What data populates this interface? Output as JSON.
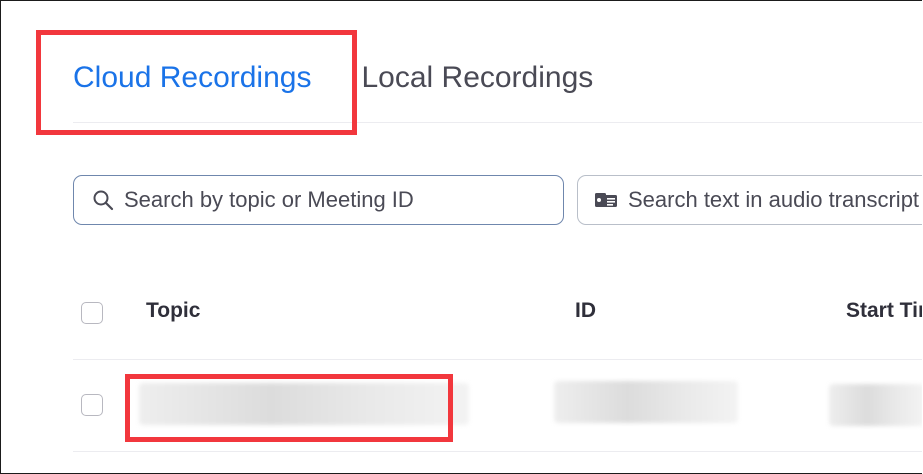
{
  "tabs": [
    {
      "label": "Cloud Recordings",
      "active": true
    },
    {
      "label": "Local Recordings",
      "active": false
    }
  ],
  "search": {
    "topic_placeholder": "Search by topic or Meeting ID",
    "transcript_placeholder": "Search text in audio transcript"
  },
  "table": {
    "columns": [
      "Topic",
      "ID",
      "Start Time"
    ],
    "rows": [
      {
        "topic": "",
        "id": "",
        "start_time": "",
        "redacted": true
      }
    ]
  },
  "colors": {
    "accent": "#1a73e8",
    "annotation": "#f2373d",
    "text": "#4a4a55"
  },
  "icons": {
    "topic_search": "search-icon",
    "transcript_search": "transcript-icon"
  }
}
